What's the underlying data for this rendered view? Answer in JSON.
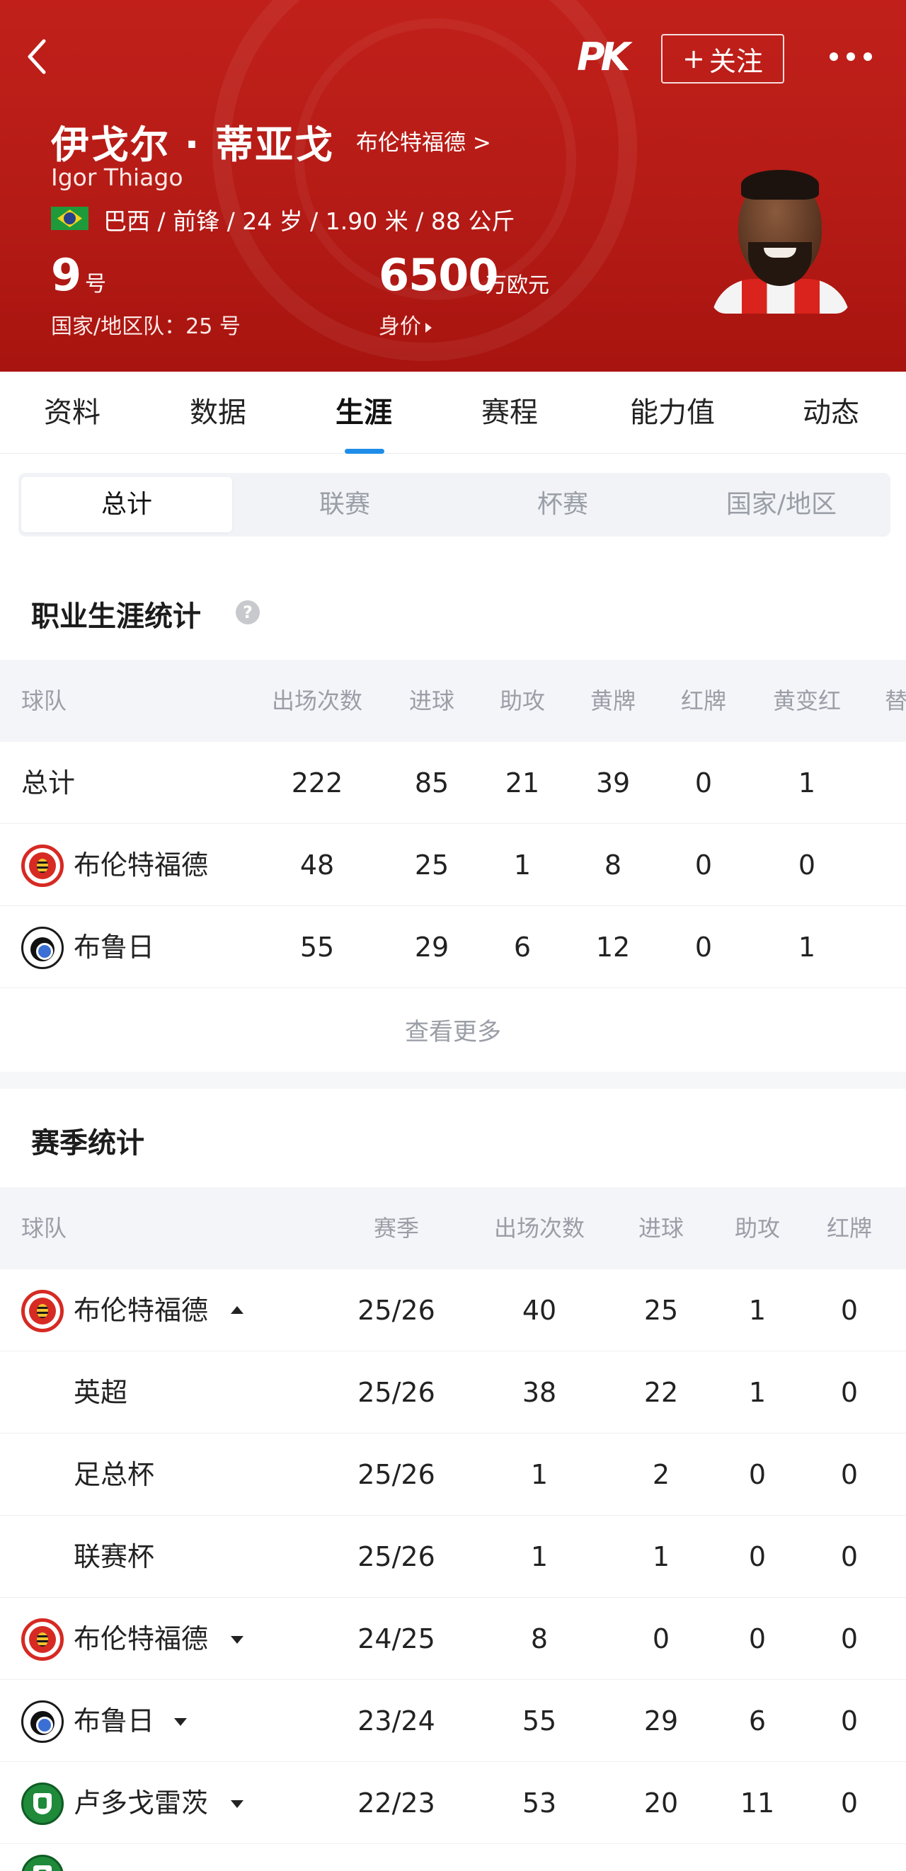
{
  "header": {
    "follow_label": "关注",
    "follow_plus": "+",
    "app_logo": "PK",
    "player_name_cn": "伊戈尔 · 蒂亚戈",
    "club_link": "布伦特福德 >",
    "player_name_en": "Igor Thiago",
    "flag": "brazil-flag-icon",
    "bio": "巴西 / 前锋 / 24 岁 / 1.90 米 / 88 公斤",
    "shirt_number": "9",
    "shirt_unit": "号",
    "national_team": "国家/地区队：25 号",
    "market_value": "6500",
    "market_value_unit": "万欧元",
    "market_value_label": "身价",
    "colors": {
      "header_red": "#b51b16",
      "accent_blue": "#1e8de8"
    }
  },
  "tabs": [
    "资料",
    "数据",
    "生涯",
    "赛程",
    "能力值",
    "动态"
  ],
  "active_tab": "生涯",
  "subtabs": [
    "总计",
    "联赛",
    "杯赛",
    "国家/地区"
  ],
  "active_subtab": "总计",
  "career": {
    "title": "职业生涯统计",
    "help_icon": "?",
    "columns": [
      "球队",
      "出场次数",
      "进球",
      "助攻",
      "黄牌",
      "红牌",
      "黄变红",
      "替"
    ],
    "rows": [
      {
        "team": "总计",
        "logo": "",
        "cells": [
          "222",
          "85",
          "21",
          "39",
          "0",
          "1"
        ]
      },
      {
        "team": "布伦特福德",
        "logo": "brentford-logo-icon",
        "cells": [
          "48",
          "25",
          "1",
          "8",
          "0",
          "0"
        ]
      },
      {
        "team": "布鲁日",
        "logo": "club-brugge-logo-icon",
        "cells": [
          "55",
          "29",
          "6",
          "12",
          "0",
          "1"
        ]
      }
    ],
    "see_more": "查看更多"
  },
  "season": {
    "title": "赛季统计",
    "columns": [
      "球队",
      "赛季",
      "出场次数",
      "进球",
      "助攻",
      "红牌"
    ],
    "rows": [
      {
        "team": "布伦特福德",
        "logo": "brentford-logo-icon",
        "caret": "up",
        "cells": [
          "25/26",
          "40",
          "25",
          "1",
          "0"
        ]
      },
      {
        "team": "英超",
        "logo": "",
        "caret": "",
        "cells": [
          "25/26",
          "38",
          "22",
          "1",
          "0"
        ]
      },
      {
        "team": "足总杯",
        "logo": "",
        "caret": "",
        "cells": [
          "25/26",
          "1",
          "2",
          "0",
          "0"
        ]
      },
      {
        "team": "联赛杯",
        "logo": "",
        "caret": "",
        "cells": [
          "25/26",
          "1",
          "1",
          "0",
          "0"
        ]
      },
      {
        "team": "布伦特福德",
        "logo": "brentford-logo-icon",
        "caret": "down",
        "cells": [
          "24/25",
          "8",
          "0",
          "0",
          "0"
        ]
      },
      {
        "team": "布鲁日",
        "logo": "club-brugge-logo-icon",
        "caret": "down",
        "cells": [
          "23/24",
          "55",
          "29",
          "6",
          "0"
        ]
      },
      {
        "team": "卢多戈雷茨",
        "logo": "ludogorets-logo-icon",
        "caret": "down",
        "cells": [
          "22/23",
          "53",
          "20",
          "11",
          "0"
        ]
      }
    ]
  }
}
